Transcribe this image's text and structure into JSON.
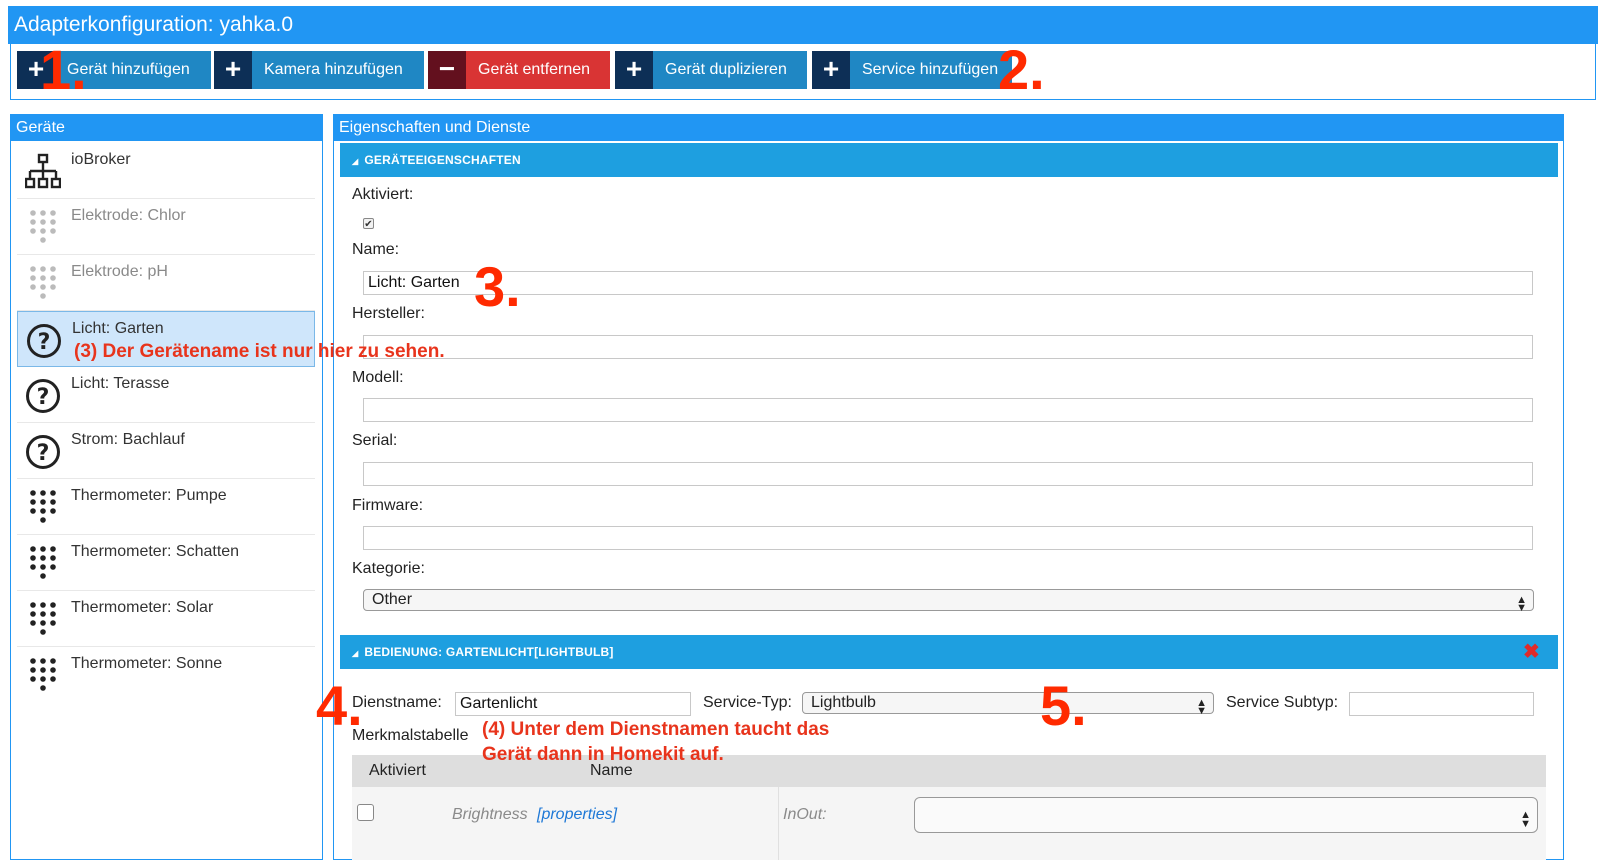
{
  "window": {
    "title": "Adapterkonfiguration: yahka.0"
  },
  "toolbar": {
    "buttons": [
      {
        "label": "Gerät hinzufügen",
        "icon": "+"
      },
      {
        "label": "Kamera hinzufügen",
        "icon": "+"
      },
      {
        "label": "Gerät entfernen",
        "icon": "−"
      },
      {
        "label": "Gerät duplizieren",
        "icon": "+"
      },
      {
        "label": "Service hinzufügen",
        "icon": "+"
      }
    ]
  },
  "devices": {
    "header": "Geräte",
    "items": [
      {
        "label": "ioBroker",
        "icon": "network-icon"
      },
      {
        "label": "Elektrode: Chlor",
        "icon": "keypad-icon"
      },
      {
        "label": "Elektrode: pH",
        "icon": "keypad-icon"
      },
      {
        "label": "Licht: Garten",
        "icon": "question-icon"
      },
      {
        "label": "Licht: Terasse",
        "icon": "question-icon"
      },
      {
        "label": "Strom: Bachlauf",
        "icon": "question-icon"
      },
      {
        "label": "Thermometer: Pumpe",
        "icon": "keypad-icon"
      },
      {
        "label": "Thermometer: Schatten",
        "icon": "keypad-icon"
      },
      {
        "label": "Thermometer: Solar",
        "icon": "keypad-icon"
      },
      {
        "label": "Thermometer: Sonne",
        "icon": "keypad-icon"
      }
    ]
  },
  "properties": {
    "header": "Eigenschaften und Dienste",
    "section_title": "GERÄTEEIGENSCHAFTEN",
    "activated_label": "Aktiviert:",
    "name_label": "Name:",
    "name_value": "Licht: Garten",
    "manufacturer_label": "Hersteller:",
    "model_label": "Modell:",
    "serial_label": "Serial:",
    "firmware_label": "Firmware:",
    "category_label": "Kategorie:",
    "category_value": "Other"
  },
  "service": {
    "section_title": "BEDIENUNG: GARTENLICHT[LIGHTBULB]",
    "name_label": "Dienstname:",
    "name_value": "Gartenlicht",
    "type_label": "Service-Typ:",
    "type_value": "Lightbulb",
    "subtype_label": "Service Subtyp:",
    "table_label": "Merkmalstabelle",
    "columns": [
      "Aktiviert",
      "Name"
    ],
    "row": {
      "name": "Brightness",
      "link": "[properties]",
      "inout_label": "InOut:"
    }
  },
  "annotations": {
    "n1": "1.",
    "n2": "2.",
    "n3": "3.",
    "n4": "4.",
    "n5": "5.",
    "note3": "(3) Der Gerätename ist nur hier zu sehen.",
    "note4_line1": "(4) Unter dem Dienstnamen taucht das",
    "note4_line2": "Gerät dann in Homekit auf."
  },
  "colors": {
    "accent": "#2196f3",
    "remove": "#d93434",
    "annotation": "#ff2a00"
  }
}
